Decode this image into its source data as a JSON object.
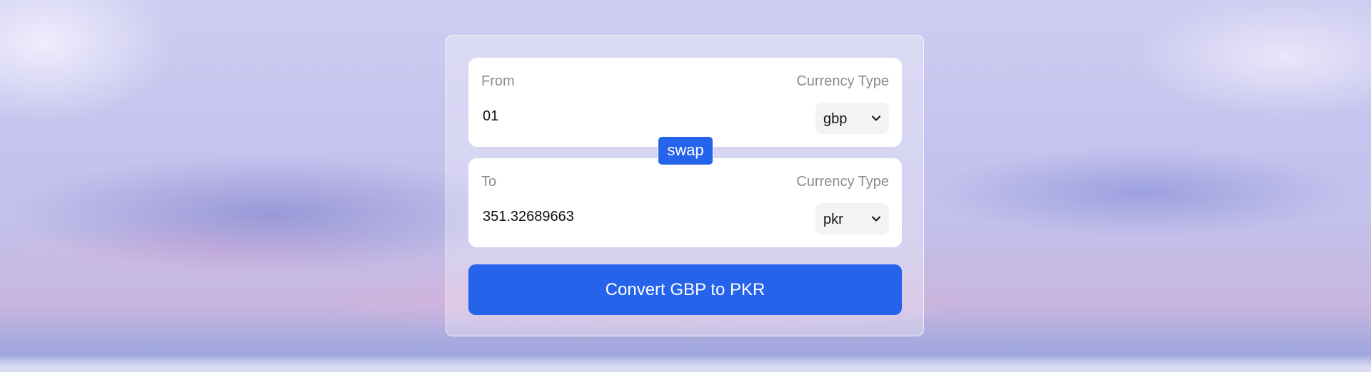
{
  "from": {
    "label": "From",
    "currency_type_label": "Currency Type",
    "amount": "01",
    "currency": "gbp"
  },
  "to": {
    "label": "To",
    "currency_type_label": "Currency Type",
    "amount": "351.32689663",
    "currency": "pkr"
  },
  "swap_label": "swap",
  "convert_label": "Convert GBP to PKR",
  "colors": {
    "accent": "#2563eb",
    "panel": "#ffffff",
    "muted_text": "#8c8c8c"
  },
  "icons": {
    "dropdown": "chevron-down-icon"
  }
}
